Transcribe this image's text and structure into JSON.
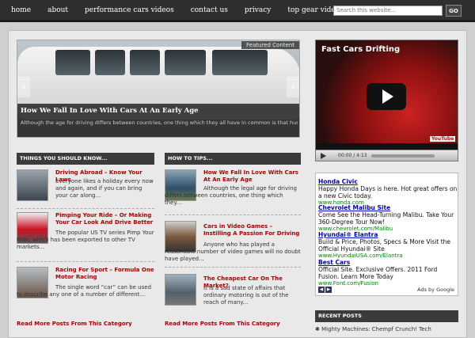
{
  "nav": [
    "home",
    "about",
    "performance cars videos",
    "contact us",
    "privacy",
    "top gear videos"
  ],
  "search": {
    "placeholder": "Search this website...",
    "button": "GO"
  },
  "featured": {
    "label": "Featured Content",
    "title": "How We Fall In Love With Cars At An Early Age",
    "text": "Although the age for driving differs between countries, one thing which they all have in common is that human early age we all want to be behind the wheel in some condition and that however most we've first gotten into the cars"
  },
  "video": {
    "title": "Fast Cars Drifting",
    "time": "00:00 / 4:13",
    "brand": "YouTube"
  },
  "left_col": {
    "heading": "THINGS YOU SHOULD KNOW...",
    "posts": [
      {
        "title": "Driving Abroad – Know Your Laws",
        "text": "Everyone likes a holiday every now and again, and if you can bring your car along..."
      },
      {
        "title": "Pimping Your Ride – Or Making Your Car Look And Drive Better",
        "text": "The popular US TV series Pimp Your Ride, which has been exported to other TV markets..."
      },
      {
        "title": "Racing For Sport – Formula One Motor Racing",
        "text": "The single word “car” can be used to describe any one of a number of different..."
      }
    ],
    "more": "Read More Posts From This Category"
  },
  "mid_col": {
    "heading": "HOW TO TIPS...",
    "posts": [
      {
        "title": "How We Fall In Love With Cars At An Early Age",
        "text": "Although the legal age for driving differs between countries, one thing which they..."
      },
      {
        "title": "Cars in Video Games – Instilling A Passion For Driving",
        "text": "Anyone who has played a reasonable number of video games will no doubt have played..."
      },
      {
        "title": "The Cheapest Car On The Market?",
        "text": "It is a sad state of affairs that ordinary motoring is out of the reach of many..."
      }
    ],
    "more": "Read More Posts From This Category"
  },
  "ads": {
    "items": [
      {
        "title": "Honda Civic",
        "desc": "Happy Honda Days is here. Hot great offers on a new Civic today.",
        "url": "www.honda.com"
      },
      {
        "title": "Chevrolet Malibu Site",
        "desc": "Come See the Head-Turning Malibu. Take Your 360-Degree Tour Now!",
        "url": "www.chevrolet.com/Malibu"
      },
      {
        "title": "Hyundai® Elantra",
        "desc": "Build & Price, Photos, Specs & More Visit the Official Hyundai® Site",
        "url": "www.HyundaiUSA.com/Elantra"
      },
      {
        "title": "Best Cars",
        "desc": "Official Site. Exclusive Offers. 2011 Ford Fusion. Learn More Today",
        "url": "www.Ford.com/Fusion"
      }
    ],
    "adsby": "Ads by Google"
  },
  "recent": {
    "heading": "RECENT POSTS",
    "item": "Mighty Machines: Chempf Crunch! Tech"
  }
}
